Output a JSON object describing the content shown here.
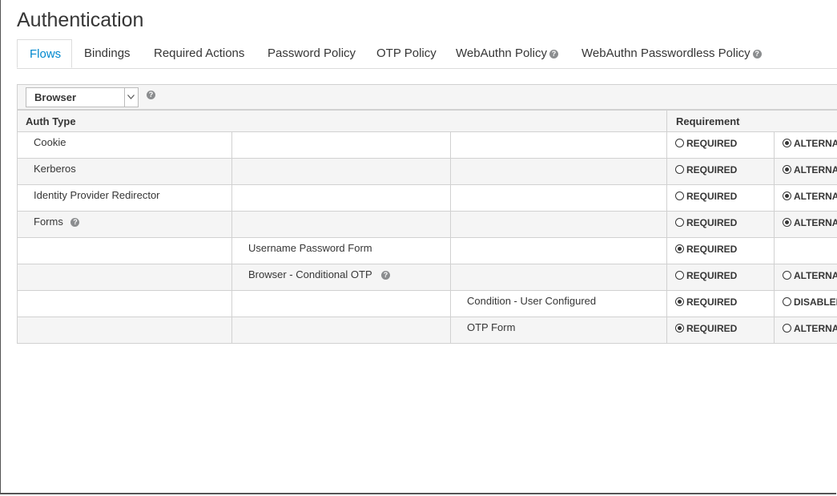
{
  "page": {
    "title": "Authentication"
  },
  "tabs": [
    {
      "label": "Flows",
      "active": true
    },
    {
      "label": "Bindings"
    },
    {
      "label": "Required Actions"
    },
    {
      "label": "Password Policy"
    },
    {
      "label": "OTP Policy"
    },
    {
      "label": "WebAuthn Policy",
      "help": true
    },
    {
      "label": "WebAuthn Passwordless Policy",
      "help": true
    }
  ],
  "toolbar": {
    "flow_select_value": "Browser"
  },
  "table": {
    "headers": {
      "auth_type": "Auth Type",
      "requirement": "Requirement"
    },
    "rows": [
      {
        "level": 1,
        "name": "Cookie",
        "req": "REQUIRED",
        "req_checked": false,
        "alt": "ALTERNATIVE",
        "alt_checked": true
      },
      {
        "level": 1,
        "name": "Kerberos",
        "req": "REQUIRED",
        "req_checked": false,
        "alt": "ALTERNATIVE",
        "alt_checked": true
      },
      {
        "level": 1,
        "name": "Identity Provider Redirector",
        "req": "REQUIRED",
        "req_checked": false,
        "alt": "ALTERNATIVE",
        "alt_checked": true
      },
      {
        "level": 1,
        "name": "Forms",
        "help": true,
        "req": "REQUIRED",
        "req_checked": false,
        "alt": "ALTERNATIVE",
        "alt_checked": true
      },
      {
        "level": 2,
        "name": "Username Password Form",
        "req": "REQUIRED",
        "req_checked": true
      },
      {
        "level": 2,
        "name": "Browser - Conditional OTP",
        "help": true,
        "req": "REQUIRED",
        "req_checked": false,
        "alt": "ALTERNATIVE",
        "alt_checked": false
      },
      {
        "level": 3,
        "name": "Condition - User Configured",
        "req": "REQUIRED",
        "req_checked": true,
        "alt": "DISABLED",
        "alt_checked": false
      },
      {
        "level": 3,
        "name": "OTP Form",
        "req": "REQUIRED",
        "req_checked": true,
        "alt": "ALTERNATIVE",
        "alt_checked": false
      }
    ]
  },
  "colors": {
    "accent": "#0088ce",
    "header_bg": "#f5f5f5",
    "border": "#d1d1d1"
  }
}
